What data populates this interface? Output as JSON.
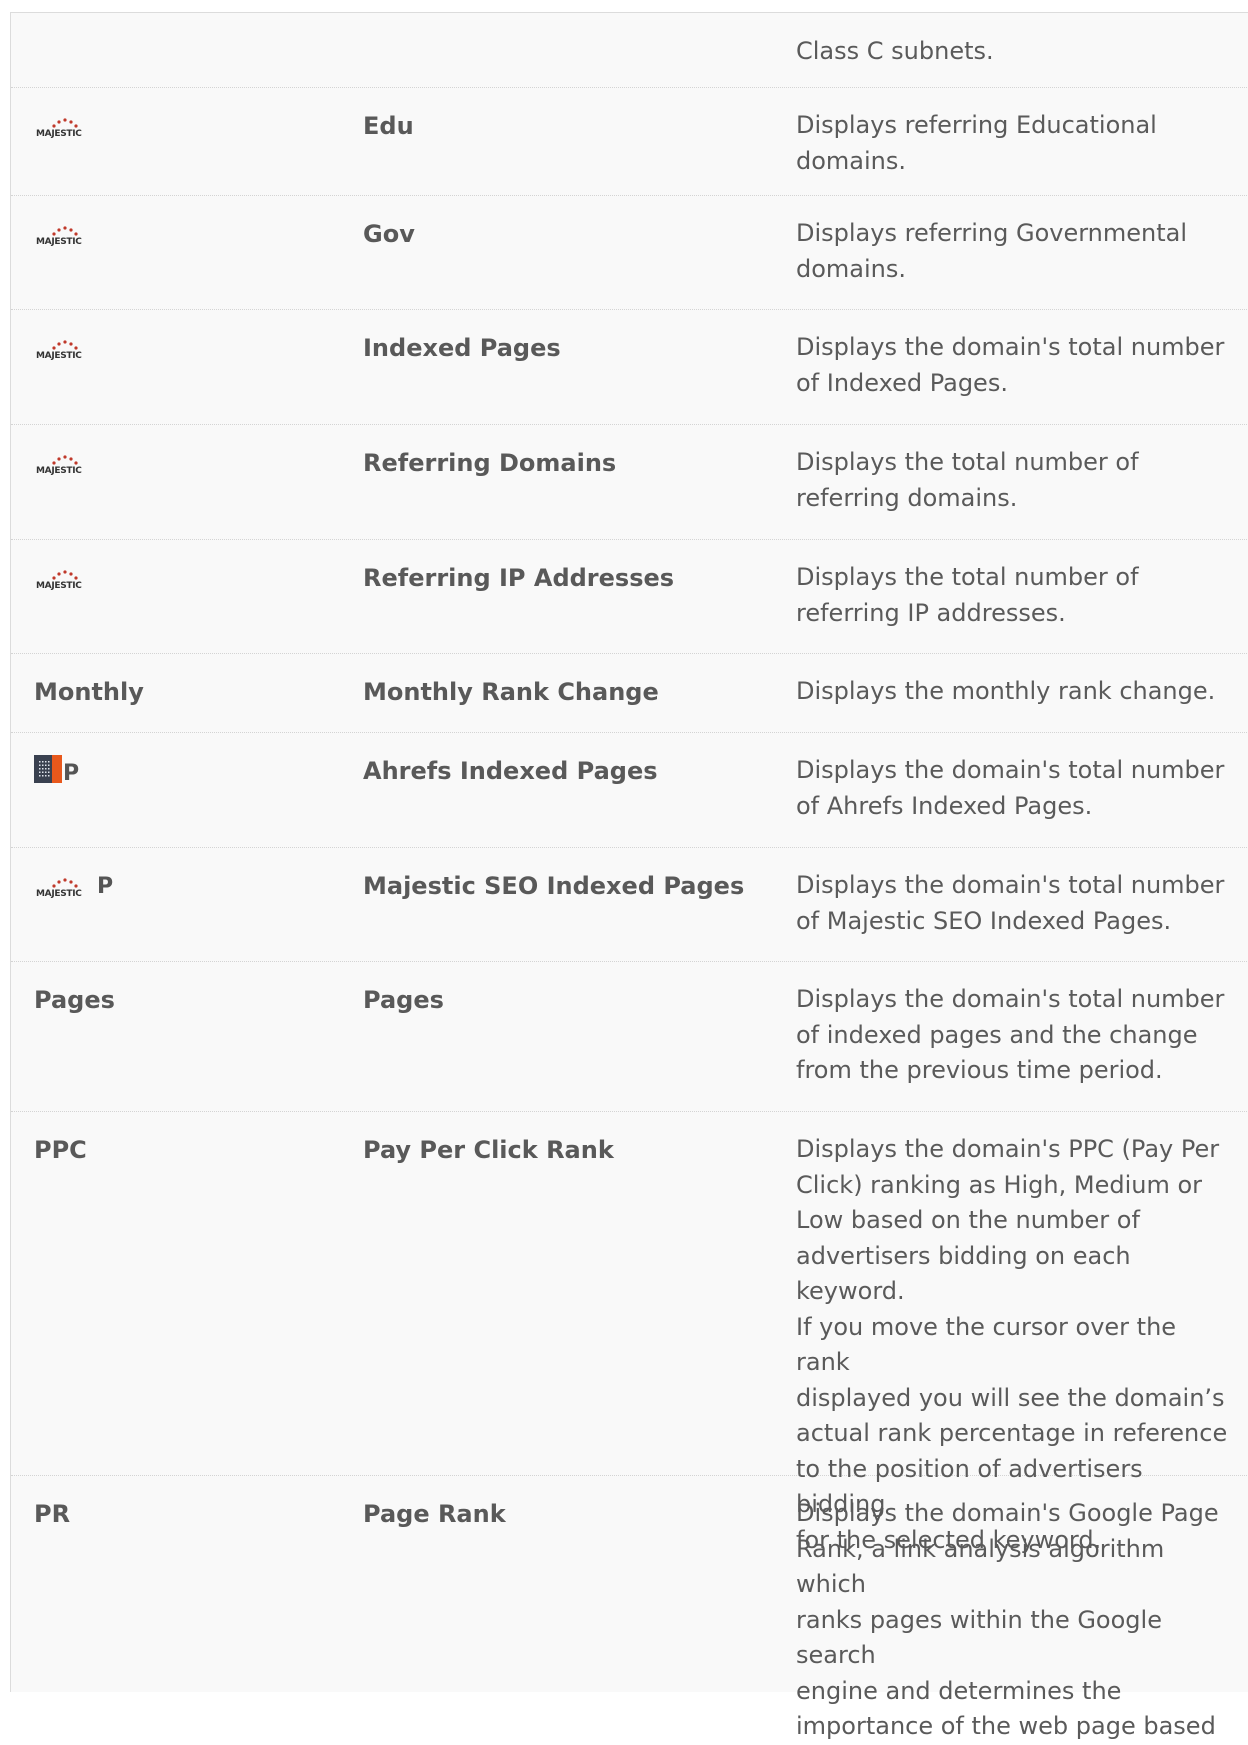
{
  "rows": [
    {
      "symbol": "",
      "logo": "",
      "name": "",
      "desc": "Class C subnets."
    },
    {
      "symbol": "",
      "logo": "majestic-logo",
      "name": "Edu",
      "desc": "Displays referring Educational\ndomains."
    },
    {
      "symbol": "",
      "logo": "majestic-logo",
      "name": "Gov",
      "desc": "Displays referring Governmental\ndomains."
    },
    {
      "symbol": "",
      "logo": "majestic-logo",
      "name": "Indexed Pages",
      "desc": "Displays the domain's total number\nof Indexed Pages."
    },
    {
      "symbol": "",
      "logo": "majestic-logo",
      "name": "Referring Domains",
      "desc": "Displays the total number of\nreferring domains."
    },
    {
      "symbol": "",
      "logo": "majestic-logo",
      "name": "Referring IP Addresses",
      "desc": "Displays the total number of\nreferring IP addresses."
    },
    {
      "symbol": "Monthly",
      "logo": "",
      "name": "Monthly Rank Change",
      "desc": "Displays the monthly rank change."
    },
    {
      "symbol": "P",
      "logo": "ahrefs-logo",
      "name": "Ahrefs Indexed Pages",
      "desc": "Displays the domain's total number\nof Ahrefs Indexed Pages."
    },
    {
      "symbol": "P",
      "logo": "majestic-logo",
      "name": "Majestic SEO Indexed Pages",
      "desc": "Displays the domain's total number\nof Majestic SEO Indexed Pages."
    },
    {
      "symbol": "Pages",
      "logo": "",
      "name": "Pages",
      "desc": "Displays the domain's total number\nof indexed pages and the change\nfrom the previous time period."
    },
    {
      "symbol": "PPC",
      "logo": "",
      "name": "Pay Per Click Rank",
      "desc": "Displays the domain's PPC (Pay Per\nClick) ranking as High, Medium or\nLow based on the number of\nadvertisers bidding on each keyword.\nIf you move the cursor over the rank\ndisplayed you will see the domain’s\nactual rank percentage in reference\nto the position of advertisers bidding\nfor the selected keyword."
    },
    {
      "symbol": "PR",
      "logo": "",
      "name": "Page Rank",
      "desc": "Displays the domain's Google Page\nRank, a link analysis algorithm which\nranks pages within the Google search\nengine and determines the\nimportance of the web page based"
    }
  ],
  "colors": {
    "background": "#f9f9f9",
    "text": "#555555",
    "majestic_red": "#c0392b",
    "ahrefs_orange": "#e8581c"
  },
  "majestic_logo_text": "MAJESTIC"
}
